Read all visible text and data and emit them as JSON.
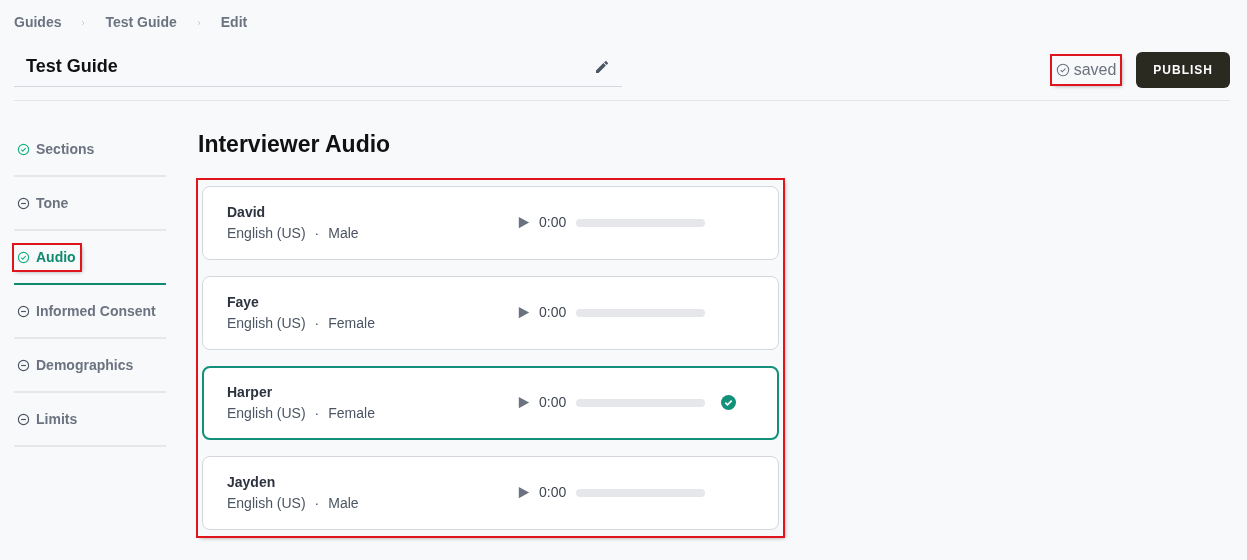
{
  "breadcrumb": [
    "Guides",
    "Test Guide",
    "Edit"
  ],
  "guide_title": "Test Guide",
  "save_status": {
    "label": "saved",
    "highlighted": true
  },
  "publish_button": "PUBLISH",
  "sidebar": {
    "items": [
      {
        "label": "Sections",
        "complete": true,
        "selected": false,
        "highlighted": false
      },
      {
        "label": "Tone",
        "complete": false,
        "selected": false,
        "highlighted": false
      },
      {
        "label": "Audio",
        "complete": true,
        "selected": true,
        "highlighted": true
      },
      {
        "label": "Informed Consent",
        "complete": false,
        "selected": false,
        "highlighted": false
      },
      {
        "label": "Demographics",
        "complete": false,
        "selected": false,
        "highlighted": false
      },
      {
        "label": "Limits",
        "complete": false,
        "selected": false,
        "highlighted": false
      }
    ]
  },
  "heading": "Interviewer Audio",
  "voices_highlighted": true,
  "voices": [
    {
      "name": "David",
      "language": "English (US)",
      "separator": "·",
      "gender": "Male",
      "time": "0:00",
      "level": 0,
      "selected": false
    },
    {
      "name": "Faye",
      "language": "English (US)",
      "separator": "·",
      "gender": "Female",
      "time": "0:00",
      "level": 0,
      "selected": false
    },
    {
      "name": "Harper",
      "language": "English (US)",
      "separator": "·",
      "gender": "Female",
      "time": "0:00",
      "level": 0,
      "selected": true
    },
    {
      "name": "Jayden",
      "language": "English (US)",
      "separator": "·",
      "gender": "Male",
      "time": "0:00",
      "level": 0,
      "selected": false
    }
  ]
}
